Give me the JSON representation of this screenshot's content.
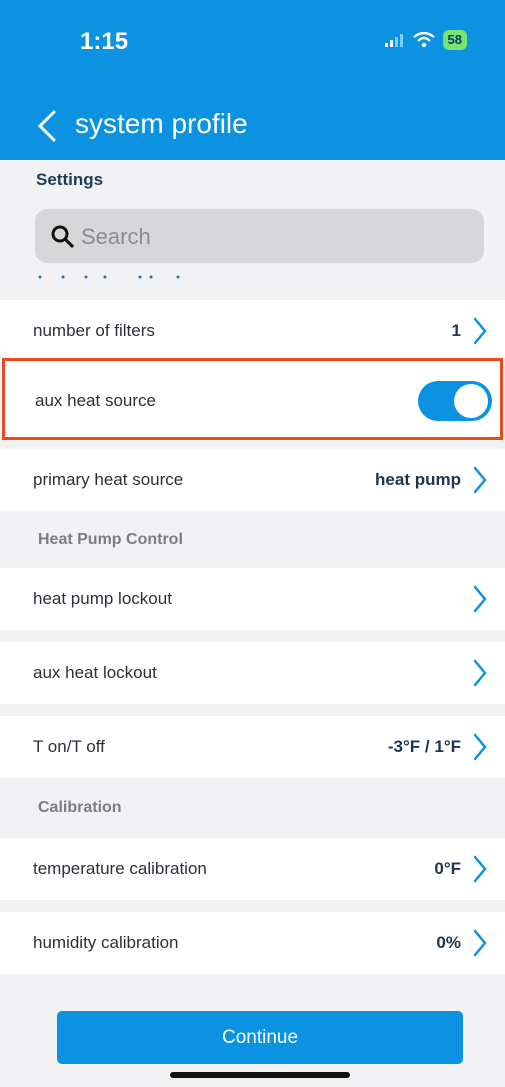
{
  "status_bar": {
    "time": "1:15",
    "battery": "58"
  },
  "header": {
    "title": "system profile"
  },
  "settings_label": "Settings",
  "search": {
    "placeholder": "Search"
  },
  "rows": {
    "number_of_filters": {
      "label": "number of filters",
      "value": "1"
    },
    "aux_heat_source": {
      "label": "aux heat source",
      "toggle_on": true
    },
    "primary_heat_source": {
      "label": "primary heat source",
      "value": "heat pump"
    },
    "heat_pump_lockout": {
      "label": "heat pump lockout"
    },
    "aux_heat_lockout": {
      "label": "aux heat lockout"
    },
    "t_on_off": {
      "label": "T on/T off",
      "value": "-3°F / 1°F"
    },
    "temperature_calibration": {
      "label": "temperature calibration",
      "value": "0°F"
    },
    "humidity_calibration": {
      "label": "humidity calibration",
      "value": "0%"
    }
  },
  "sections": {
    "heat_pump_control": "Heat Pump Control",
    "calibration": "Calibration"
  },
  "continue_label": "Continue",
  "colors": {
    "accent": "#0b92e0",
    "highlight": "#e84a1f"
  }
}
